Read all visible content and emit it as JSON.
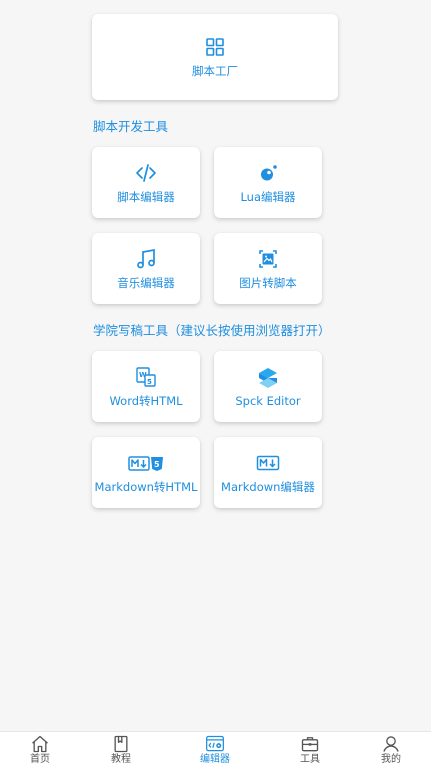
{
  "top_card": {
    "label": "脚本工厂",
    "icon": "grid-icon"
  },
  "sections": [
    {
      "title": "脚本开发工具",
      "cards": [
        {
          "label": "脚本编辑器",
          "icon": "code-icon"
        },
        {
          "label": "Lua编辑器",
          "icon": "lua-icon"
        },
        {
          "label": "音乐编辑器",
          "icon": "music-note-icon"
        },
        {
          "label": "图片转脚本",
          "icon": "image-icon"
        }
      ]
    },
    {
      "title": "学院写稿工具（建议长按使用浏览器打开）",
      "cards": [
        {
          "label": "Word转HTML",
          "icon": "word-html-icon"
        },
        {
          "label": "Spck Editor",
          "icon": "spck-logo-icon"
        },
        {
          "label": "Markdown转HTML",
          "icon": "markdown-html-icon"
        },
        {
          "label": "Markdown编辑器",
          "icon": "markdown-icon"
        }
      ]
    }
  ],
  "tabbar": {
    "items": [
      {
        "label": "首页",
        "icon": "home-icon",
        "active": false
      },
      {
        "label": "教程",
        "icon": "book-icon",
        "active": false
      },
      {
        "label": "编辑器",
        "icon": "editor-icon",
        "active": true
      },
      {
        "label": "工具",
        "icon": "toolbox-icon",
        "active": false
      },
      {
        "label": "我的",
        "icon": "user-icon",
        "active": false
      }
    ]
  },
  "colors": {
    "accent": "#1f8fe0",
    "background": "#f6f6f6",
    "card": "#ffffff",
    "tab_inactive": "#555555"
  }
}
